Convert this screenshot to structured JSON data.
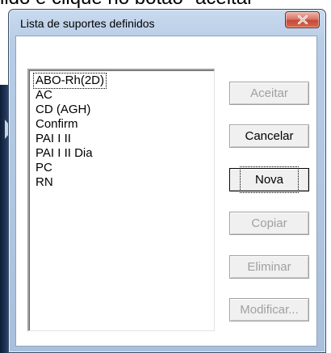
{
  "background": {
    "caption": "lido e clique no botão \"aceitar\""
  },
  "dialog": {
    "title": "Lista de suportes definidos",
    "close_icon": "close-icon"
  },
  "list": {
    "items": [
      "ABO-Rh(2D)",
      "AC",
      "CD (AGH)",
      "Confirm",
      "PAI I II",
      "PAI I II Dia",
      "PC",
      "RN"
    ]
  },
  "buttons": {
    "accept": "Aceitar",
    "cancel": "Cancelar",
    "new": "Nova",
    "copy": "Copiar",
    "delete": "Eliminar",
    "modify": "Modificar..."
  }
}
